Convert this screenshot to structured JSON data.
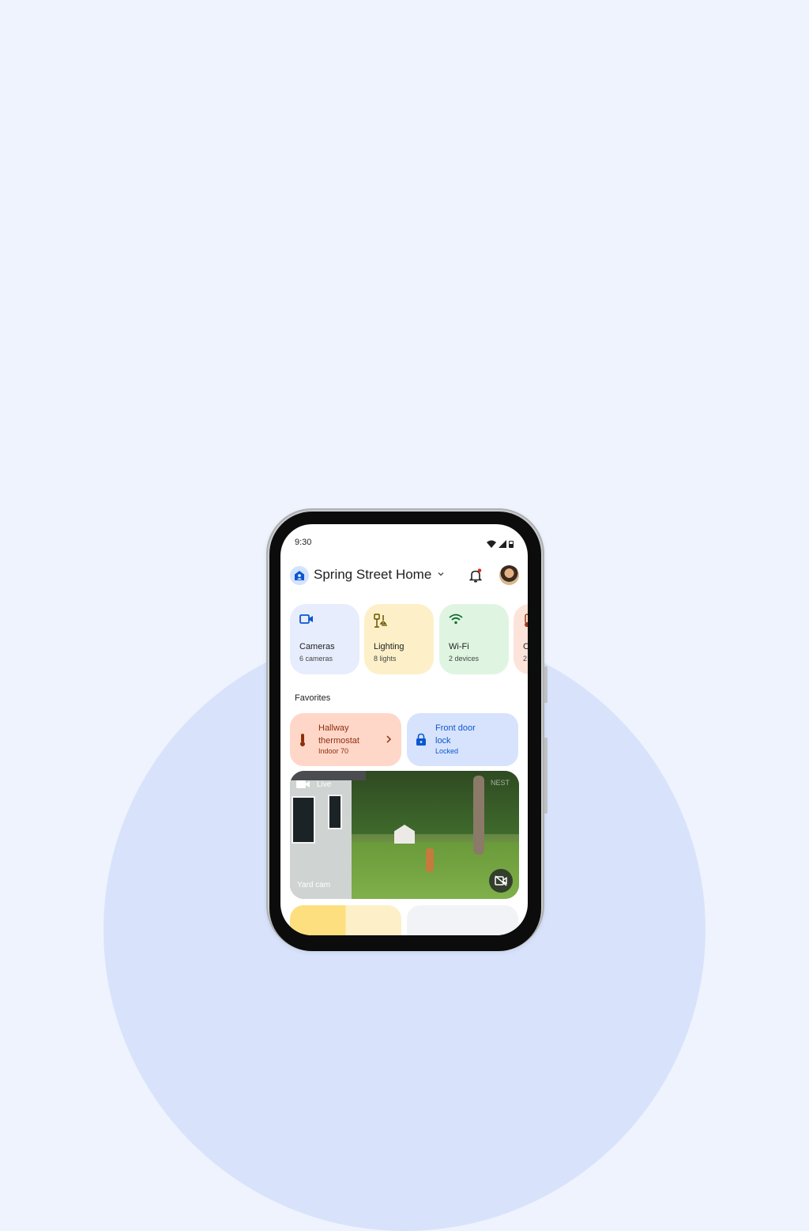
{
  "status_bar": {
    "time": "9:30"
  },
  "header": {
    "home_name": "Spring Street Home"
  },
  "tiles": [
    {
      "name": "Cameras",
      "sub": "6 cameras",
      "icon": "camera-icon",
      "bg": "#e8edfd",
      "accent": "#0b57d0"
    },
    {
      "name": "Lighting",
      "sub": "8 lights",
      "icon": "lamp-icon",
      "bg": "#fdf0c8",
      "accent": "#6b5200"
    },
    {
      "name": "Wi-Fi",
      "sub": "2 devices",
      "icon": "wifi-icon",
      "bg": "#dff5e1",
      "accent": "#146c2e"
    },
    {
      "name": "C",
      "sub": "2",
      "icon": "thermometer-icon",
      "bg": "#fde4db",
      "accent": "#a43d11"
    }
  ],
  "favorites": {
    "label": "Favorites",
    "items": [
      {
        "line1": "Hallway",
        "line2": "thermostat",
        "line3": "Indoor 70",
        "icon": "thermometer-icon",
        "bg": "#ffd7c9",
        "color": "#8c2f0c"
      },
      {
        "line1": "Front door",
        "line2": "lock",
        "line3": "Locked",
        "icon": "lock-icon",
        "bg": "#d7e3fc",
        "color": "#0b57d0"
      }
    ]
  },
  "camera_feed": {
    "live_label": "Live",
    "camera_name": "Yard cam",
    "watermark": "NEST"
  }
}
